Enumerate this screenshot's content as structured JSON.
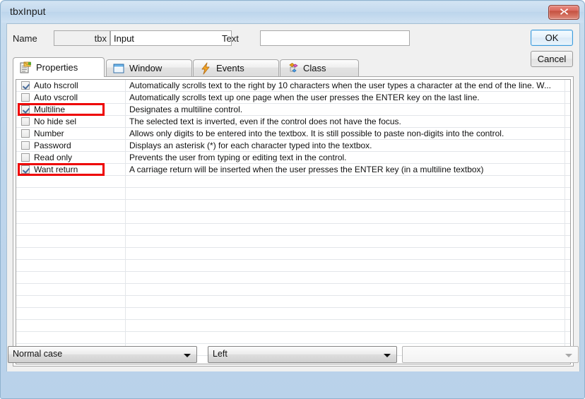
{
  "window": {
    "title": "tbxInput",
    "close_label": "✖",
    "close_icon": "close-icon"
  },
  "header": {
    "name_label": "Name",
    "name_prefix_value": "tbx",
    "name_value": "Input",
    "text_label": "Text",
    "text_value": "",
    "ok_label": "OK",
    "cancel_label": "Cancel"
  },
  "tabs": [
    {
      "label": "Properties",
      "icon": "clipboard-icon",
      "active": true
    },
    {
      "label": "Window",
      "icon": "window-icon",
      "active": false
    },
    {
      "label": "Events",
      "icon": "lightning-bolt-icon",
      "active": false
    },
    {
      "label": "Class",
      "icon": "diamonds-icon",
      "active": false
    }
  ],
  "grid": {
    "rows": [
      {
        "name": "Auto hscroll",
        "checked": true,
        "highlighted": false,
        "description": "Automatically scrolls text to the right by 10 characters when the user types a character at the end of the line. W..."
      },
      {
        "name": "Auto vscroll",
        "checked": false,
        "highlighted": false,
        "description": "Automatically scrolls text up one page when the user presses the ENTER key on the last line."
      },
      {
        "name": "Multiline",
        "checked": true,
        "highlighted": true,
        "description": "Designates a multiline control."
      },
      {
        "name": "No hide sel",
        "checked": false,
        "highlighted": false,
        "description": "The selected text is inverted, even if the control does not have the focus."
      },
      {
        "name": "Number",
        "checked": false,
        "highlighted": false,
        "description": "Allows only digits to be entered into the textbox. It is still possible to paste non-digits into the control."
      },
      {
        "name": "Password",
        "checked": false,
        "highlighted": false,
        "description": "Displays an asterisk (*) for each character typed into the textbox."
      },
      {
        "name": "Read only",
        "checked": false,
        "highlighted": false,
        "description": "Prevents the user from typing or editing text in the control."
      },
      {
        "name": "Want return",
        "checked": true,
        "highlighted": true,
        "description": "A carriage return will be inserted when the user presses the ENTER key (in a multiline textbox)"
      }
    ],
    "empty_row_count": 15
  },
  "footer": {
    "case_combo_value": "Normal case",
    "align_combo_value": "Left",
    "third_combo_value": "",
    "third_combo_disabled": true
  },
  "colors": {
    "highlight": "#ee0000",
    "title_bar": "#c3d9ee",
    "close_button": "#c4503f",
    "focus_border": "#3c9bdc"
  }
}
